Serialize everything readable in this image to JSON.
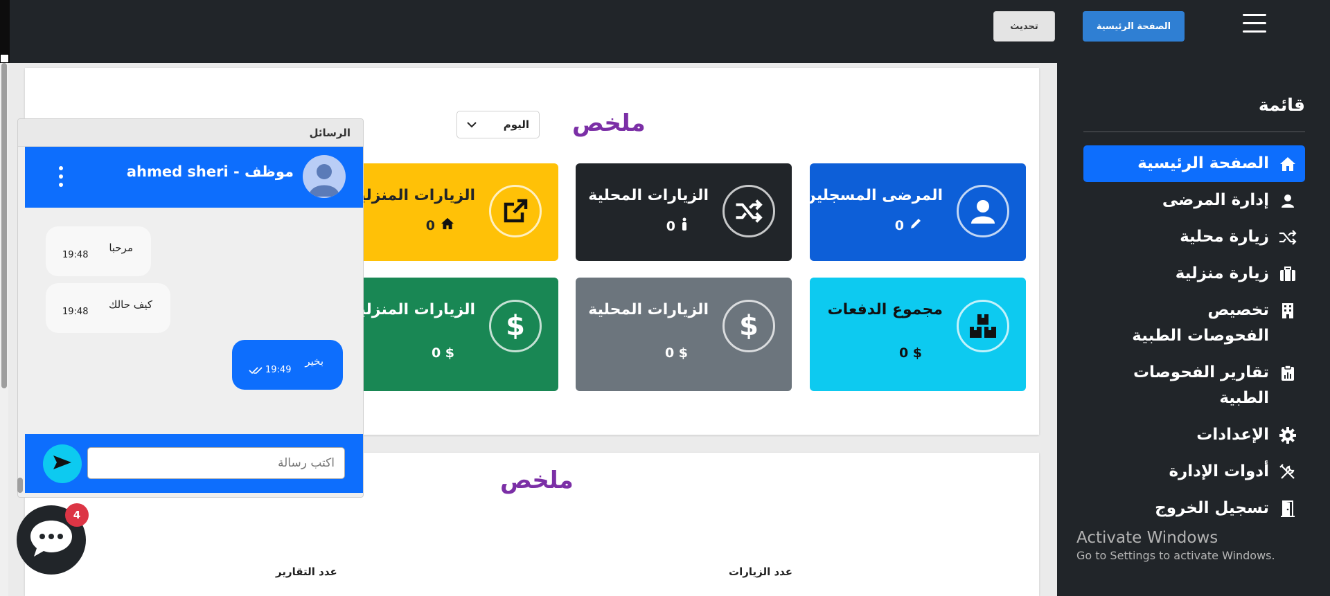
{
  "topbar": {
    "home_button": "الصفحة الرئيسية",
    "refresh_button": "تحديث"
  },
  "sidebar": {
    "title": "قائمة",
    "items": [
      {
        "label": "الصفحة الرئيسية",
        "icon": "home-icon",
        "active": true
      },
      {
        "label": "إدارة المرضى",
        "icon": "user-icon",
        "active": false
      },
      {
        "label": "زيارة محلية",
        "icon": "shuffle-icon",
        "active": false
      },
      {
        "label": "زيارة منزلية",
        "icon": "suitcase-icon",
        "active": false
      },
      {
        "label": "تخصيص الفحوصات الطبية",
        "icon": "building-icon",
        "active": false
      },
      {
        "label": "تقارير الفحوصات الطبية",
        "icon": "clipboard-icon",
        "active": false
      },
      {
        "label": "الإعدادات",
        "icon": "gear-icon",
        "active": false
      },
      {
        "label": "أدوات الإدارة",
        "icon": "tools-icon",
        "active": false
      },
      {
        "label": "تسجيل الخروج",
        "icon": "door-icon",
        "active": false
      }
    ]
  },
  "summary": {
    "title": "ملخص",
    "period": "اليوم",
    "cards": [
      {
        "title": "المرضى المسجلين",
        "value": "0",
        "color": "#0d6efd"
      },
      {
        "title": "الزيارات المحلية",
        "value": "0",
        "color": "#212529"
      },
      {
        "title": "الزيارات المنزلية",
        "value": "0",
        "color": "#ffc107"
      },
      {
        "title": "مجموع الدفعات",
        "value": "0 $",
        "color": "#0dcaf0"
      },
      {
        "title": "الزيارات المحلية",
        "value": "0 $",
        "color": "#6c757d"
      },
      {
        "title": "الزيارات المنزلية",
        "value": "0 $",
        "color": "#198754"
      }
    ]
  },
  "summary2": {
    "title": "ملخص",
    "col_visits": "عدد الزيارات",
    "col_reports": "عدد التقارير"
  },
  "chat": {
    "header": "الرسائل",
    "user": "ahmed sheri - موظف",
    "messages": [
      {
        "text": "مرحبا",
        "time": "19:48",
        "direction": "in"
      },
      {
        "text": "كيف حالك",
        "time": "19:48",
        "direction": "in"
      },
      {
        "text": "بخير",
        "time": "19:49",
        "direction": "out"
      }
    ],
    "input_placeholder": "اكتب رسالة",
    "unread_badge": "4"
  },
  "watermark": {
    "line1": "Activate Windows",
    "line2": "Go to Settings to activate Windows."
  }
}
